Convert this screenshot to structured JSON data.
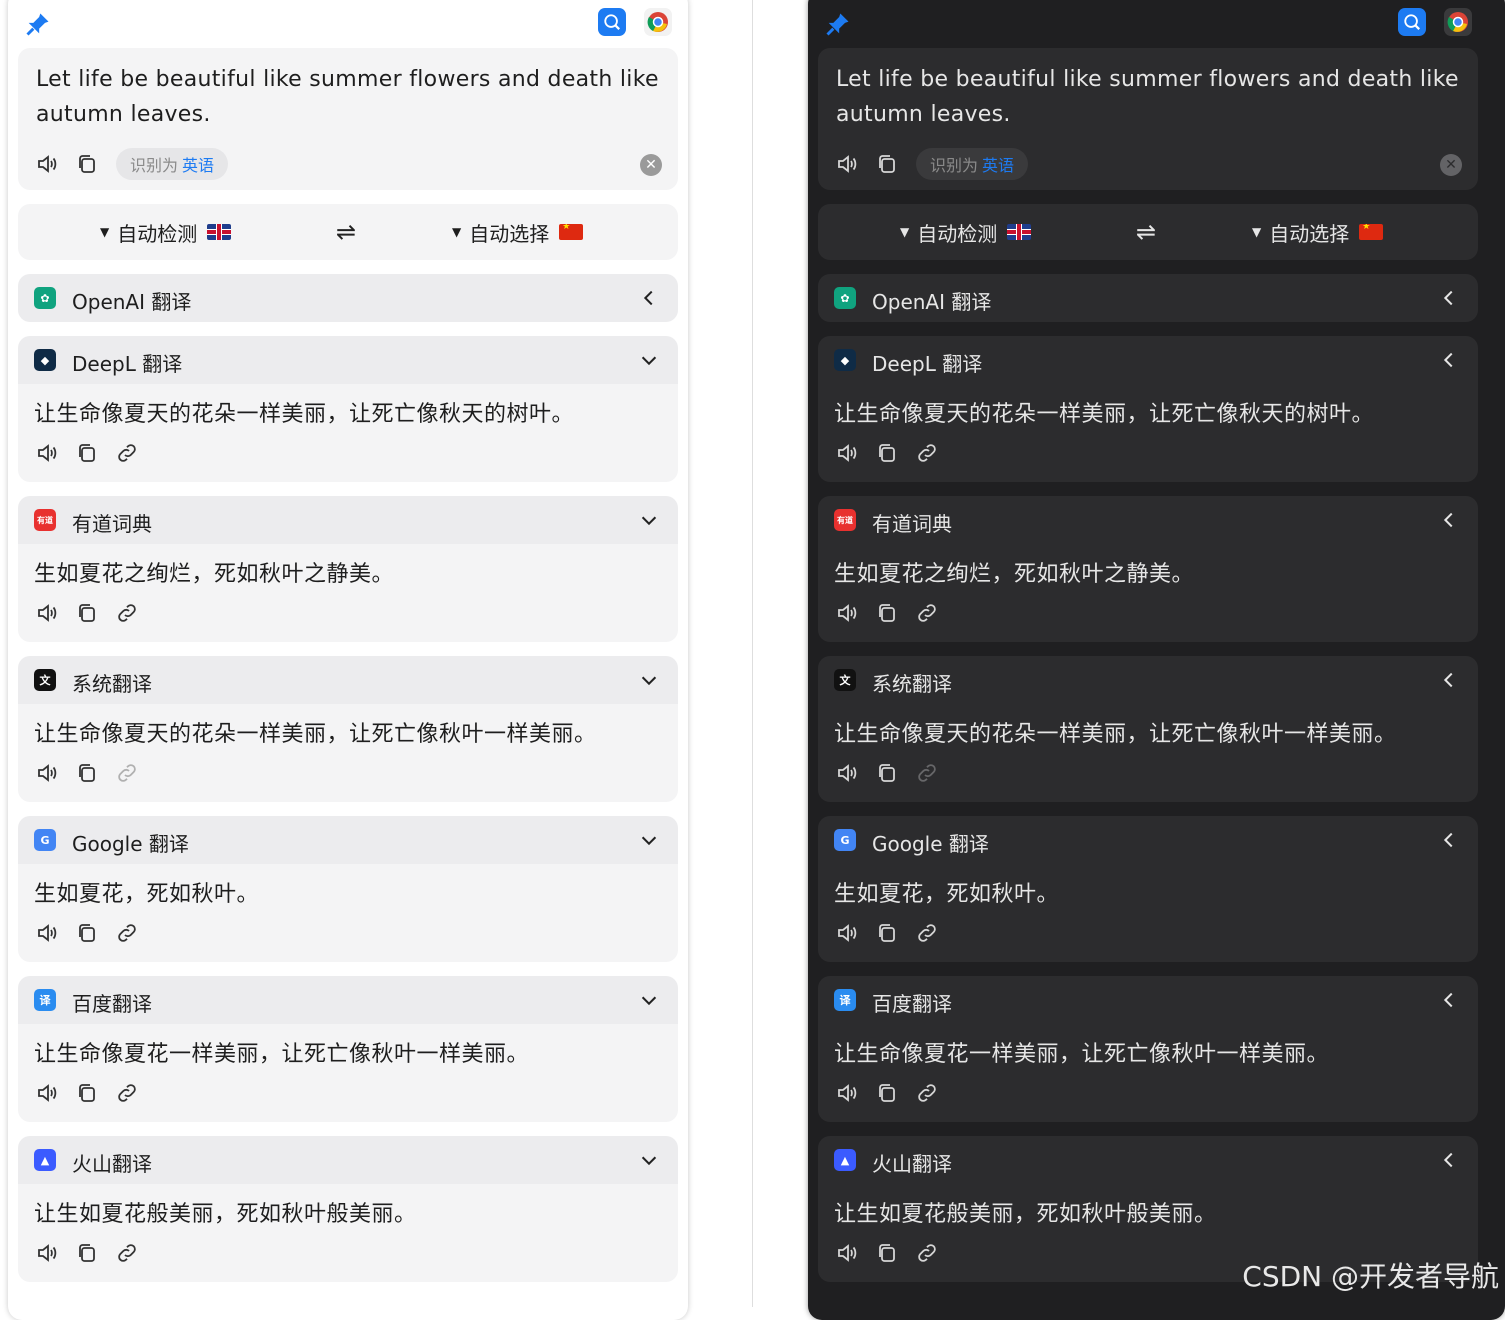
{
  "source": {
    "text": "Let life be beautiful like summer flowers and death like autumn leaves.",
    "detected_prefix": "识别为",
    "detected_lang": "英语"
  },
  "languages": {
    "from_label": "自动检测",
    "to_label": "自动选择",
    "swap_glyph": "⇌",
    "dropdown_glyph": "▼"
  },
  "services": [
    {
      "name": "OpenAI 翻译",
      "icon": "openai-icon",
      "color": "#10a37f",
      "collapsed": true,
      "result": "",
      "link_faded": false
    },
    {
      "name": "DeepL 翻译",
      "icon": "deepl-icon",
      "color": "#0f2b46",
      "collapsed": false,
      "result": "让生命像夏天的花朵一样美丽，让死亡像秋天的树叶。",
      "link_faded": false
    },
    {
      "name": "有道词典",
      "icon": "youdao-icon",
      "color": "#e8312f",
      "collapsed": false,
      "result": "生如夏花之绚烂，死如秋叶之静美。",
      "link_faded": false
    },
    {
      "name": "系统翻译",
      "icon": "system-translate-icon",
      "color": "#111111",
      "collapsed": false,
      "result": "让生命像夏天的花朵一样美丽，让死亡像秋叶一样美丽。",
      "link_faded": true
    },
    {
      "name": "Google 翻译",
      "icon": "google-translate-icon",
      "color": "#4285f4",
      "collapsed": false,
      "result": "生如夏花，死如秋叶。",
      "link_faded": false
    },
    {
      "name": "百度翻译",
      "icon": "baidu-translate-icon",
      "color": "#2a8cf0",
      "collapsed": false,
      "result": "让生命像夏花一样美丽，让死亡像秋叶一样美丽。",
      "link_faded": false
    },
    {
      "name": "火山翻译",
      "icon": "volcano-translate-icon",
      "color": "#3b5bff",
      "collapsed": false,
      "result": "让生如夏花般美丽，死如秋叶般美丽。",
      "link_faded": false
    }
  ],
  "colors": {
    "accent": "#1d7bf2",
    "pin": "#1d7bf2"
  },
  "watermark": "CSDN @开发者导航"
}
